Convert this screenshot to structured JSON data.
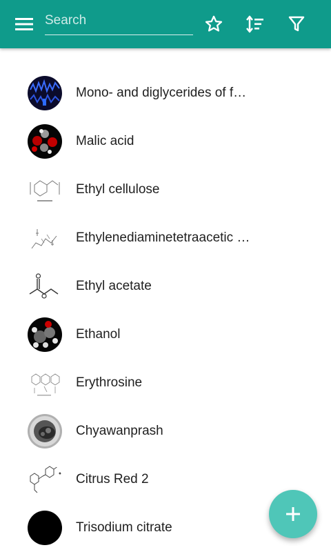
{
  "appbar": {
    "color": "#0f9b8b",
    "search_placeholder": "Search",
    "icons": [
      "menu-icon",
      "star-outline-icon",
      "sort-icon",
      "filter-icon"
    ]
  },
  "items": [
    {
      "name": "Mono- and diglycerides of fatty acids",
      "display": "Mono- and diglycerides of f…",
      "thumb": "spectrum"
    },
    {
      "name": "Malic acid",
      "display": "Malic acid",
      "thumb": "ball-model-red"
    },
    {
      "name": "Ethyl cellulose",
      "display": "Ethyl cellulose",
      "thumb": "structure-formula"
    },
    {
      "name": "Ethylenediaminetetraacetic acid",
      "display": "Ethylenediaminetetraacetic …",
      "thumb": "structure-formula"
    },
    {
      "name": "Ethyl acetate",
      "display": "Ethyl acetate",
      "thumb": "structure-formula"
    },
    {
      "name": "Ethanol",
      "display": "Ethanol",
      "thumb": "ball-model"
    },
    {
      "name": "Erythrosine",
      "display": "Erythrosine",
      "thumb": "structure-formula"
    },
    {
      "name": "Chyawanprash",
      "display": "Chyawanprash",
      "thumb": "photo"
    },
    {
      "name": "Citrus Red 2",
      "display": "Citrus Red 2",
      "thumb": "structure-formula"
    },
    {
      "name": "Trisodium citrate",
      "display": "Trisodium citrate",
      "thumb": "black-circle"
    }
  ],
  "fab": {
    "icon": "plus-icon",
    "color": "#4fc6b8"
  }
}
